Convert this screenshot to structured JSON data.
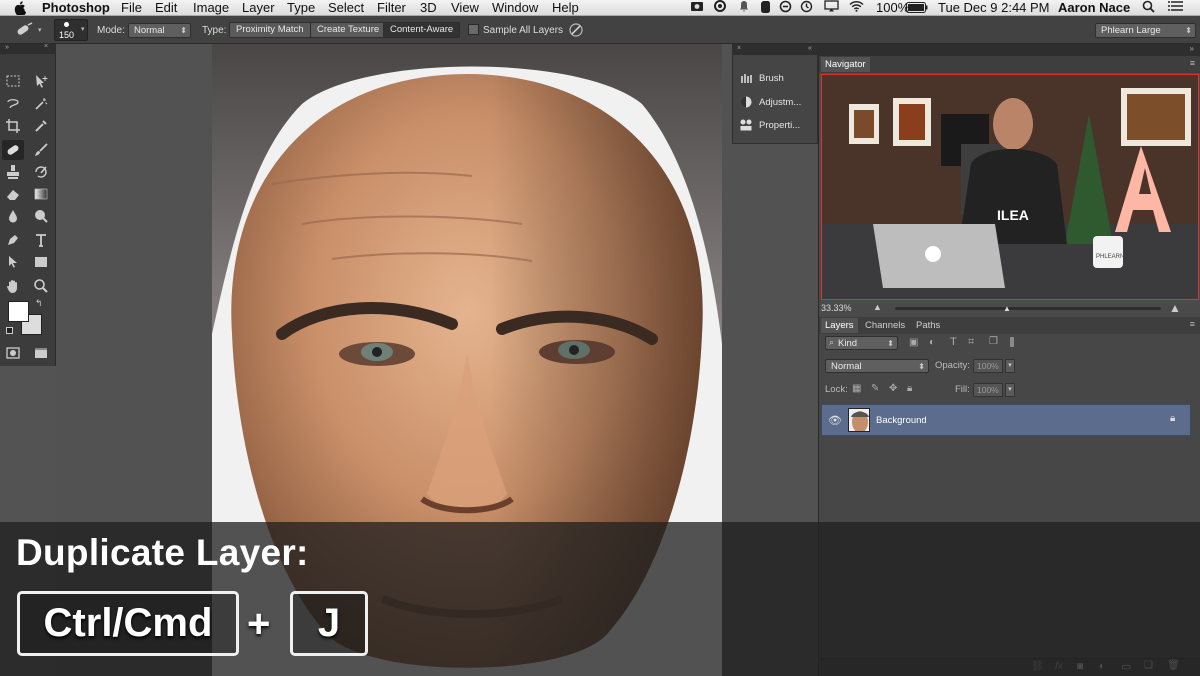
{
  "menubar": {
    "app": "Photoshop",
    "items": [
      "File",
      "Edit",
      "Image",
      "Layer",
      "Type",
      "Select",
      "Filter",
      "3D",
      "View",
      "Window",
      "Help"
    ],
    "battery": "100%",
    "datetime": "Tue Dec 9  2:44 PM",
    "user": "Aaron Nace"
  },
  "options": {
    "brush_size": "150",
    "mode_label": "Mode:",
    "mode_value": "Normal",
    "type_label": "Type:",
    "type_buttons": [
      "Proximity Match",
      "Create Texture",
      "Content-Aware"
    ],
    "sample_all": "Sample All Layers",
    "workspace": "Phlearn Large"
  },
  "collapsed_panels": [
    "Brush",
    "Adjustm...",
    "Properti..."
  ],
  "navigator": {
    "tab": "Navigator",
    "zoom": "33.33%",
    "thumb_logo": "PHLEARN"
  },
  "layers": {
    "tabs": [
      "Layers",
      "Channels",
      "Paths"
    ],
    "kind": "Kind",
    "blend": "Normal",
    "opacity_label": "Opacity:",
    "opacity_value": "100%",
    "lock_label": "Lock:",
    "fill_label": "Fill:",
    "fill_value": "100%",
    "layer_name": "Background"
  },
  "overlay": {
    "title": "Duplicate Layer:",
    "key1": "Ctrl/Cmd",
    "plus": "+",
    "key2": "J"
  },
  "colors": {
    "selected_layer": "#5b6c8d",
    "panel_bg": "#4a4a4a"
  }
}
